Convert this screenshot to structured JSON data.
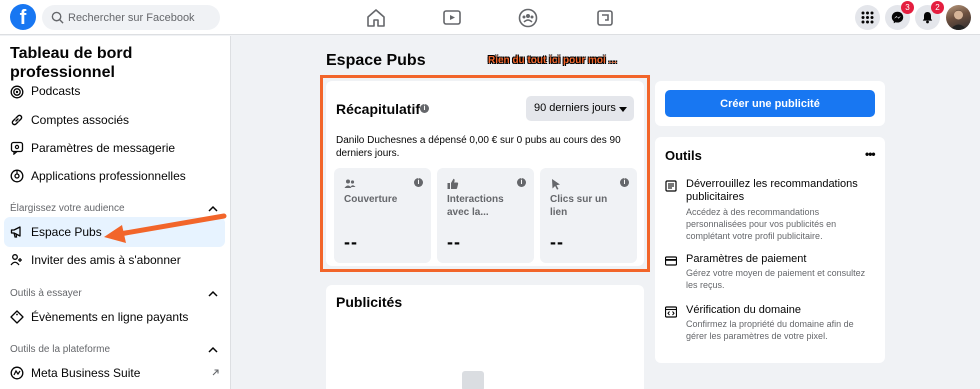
{
  "topbar": {
    "logo": "f",
    "search_placeholder": "Rechercher sur Facebook",
    "messenger_badge": "3",
    "notifications_badge": "2"
  },
  "sidebar": {
    "title": "Tableau de bord professionnel",
    "items_top": [
      {
        "label": "Podcasts",
        "icon": "podcast-icon"
      },
      {
        "label": "Comptes associés",
        "icon": "link-icon"
      },
      {
        "label": "Paramètres de messagerie",
        "icon": "chat-settings-icon"
      },
      {
        "label": "Applications professionnelles",
        "icon": "apps-icon"
      }
    ],
    "section_audience": "Élargissez votre audience",
    "items_audience": [
      {
        "label": "Espace Pubs",
        "icon": "megaphone-icon"
      },
      {
        "label": "Inviter des amis à s'abonner",
        "icon": "invite-friends-icon"
      }
    ],
    "section_tools": "Outils à essayer",
    "items_tools": [
      {
        "label": "Évènements en ligne payants",
        "icon": "ticket-icon"
      }
    ],
    "section_platform": "Outils de la plateforme",
    "items_platform": [
      {
        "label": "Meta Business Suite",
        "icon": "meta-business-icon"
      }
    ]
  },
  "main": {
    "title": "Espace Pubs",
    "annotation": "Rien du tout ici pour moi ...",
    "recap": {
      "title": "Récapitulatif",
      "period": "90 derniers jours",
      "description": "Danilo Duchesnes a dépensé 0,00 € sur 0 pubs au cours des 90 derniers jours.",
      "metrics": [
        {
          "label": "Couverture",
          "value": "--",
          "icon": "people-icon"
        },
        {
          "label": "Interactions avec la...",
          "value": "--",
          "icon": "thumbs-up-icon"
        },
        {
          "label": "Clics sur un lien",
          "value": "--",
          "icon": "cursor-icon"
        }
      ]
    },
    "ads_title": "Publicités"
  },
  "right": {
    "create_button": "Créer une publicité",
    "tools_title": "Outils",
    "tools": [
      {
        "title": "Déverrouillez les recommandations publicitaires",
        "desc": "Accédez à des recommandations personnalisées pour vos publicités en complétant votre profil publicitaire.",
        "icon": "recommendations-icon"
      },
      {
        "title": "Paramètres de paiement",
        "desc": "Gérez votre moyen de paiement et consultez les reçus.",
        "icon": "credit-card-icon"
      },
      {
        "title": "Vérification du domaine",
        "desc": "Confirmez la propriété du domaine afin de gérer les paramètres de votre pixel.",
        "icon": "code-window-icon"
      }
    ]
  },
  "colors": {
    "brand": "#1877f2",
    "highlight": "#f2652a",
    "badge": "#e41e3f"
  }
}
